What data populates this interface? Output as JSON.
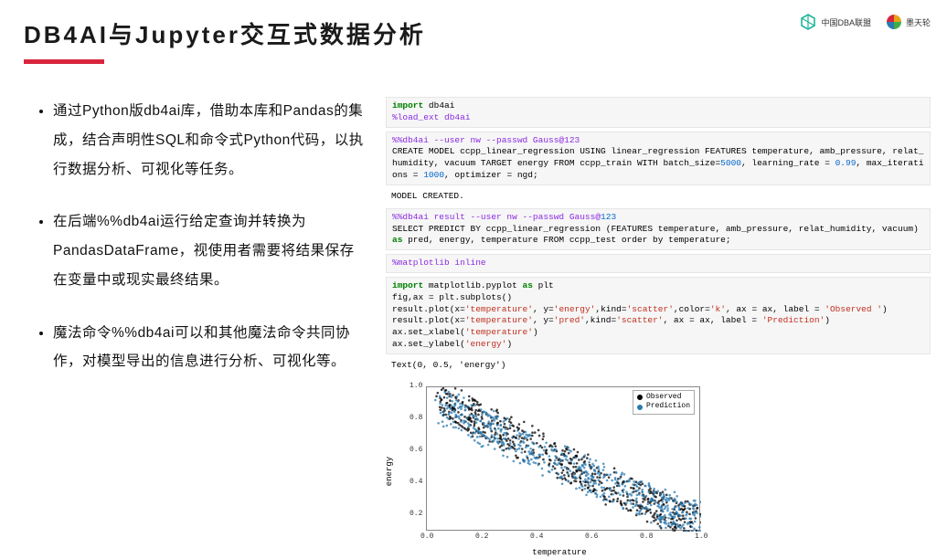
{
  "title": "DB4AI与Jupyter交互式数据分析",
  "logos": {
    "left_text": "中国DBA联盟",
    "right_text": "墨天轮"
  },
  "bullets": [
    "通过Python版db4ai库，借助本库和Pandas的集成，结合声明性SQL和命令式Python代码，以执行数据分析、可视化等任务。",
    "在后端%%db4ai运行给定查询并转换为PandasDataFrame，视使用者需要将结果保存在变量中或现实最终结果。",
    "魔法命令%%db4ai可以和其他魔法命令共同协作，对模型导出的信息进行分析、可视化等。"
  ],
  "code_cells": {
    "c1a": "import",
    "c1b": " db4ai\n",
    "c1c": "%load_ext db4ai",
    "c2a": "%%db4ai --user nw --passwd Gauss@123",
    "c2b": "\nCREATE MODEL ccpp_linear_regression USING linear_regression FEATURES temperature, amb_pressure, relat_humidity, vacuum TARGET energy FROM ccpp_train WITH batch_size=",
    "c2c": "5000",
    "c2d": ", learning_rate = ",
    "c2e": "0.99",
    "c2f": ", max_iterations = ",
    "c2g": "1000",
    "c2h": ", optimizer = ngd;",
    "out1": "MODEL CREATED.",
    "c3a": "%%db4ai result --user nw --passwd Gauss@",
    "c3b": "123",
    "c3c": "\nSELECT PREDICT BY ccpp_linear_regression (FEATURES temperature, amb_pressure, relat_humidity, vacuum) ",
    "c3d": "as",
    "c3e": " pred, energy, temperature FROM ccpp_test order by temperature;",
    "c4": "%matplotlib inline",
    "c5a": "import",
    "c5b": " matplotlib.pyplot ",
    "c5c": "as",
    "c5d": " plt\nfig,ax = plt.subplots()\nresult.plot(x=",
    "c5e": "'temperature'",
    "c5f": ", y=",
    "c5g": "'energy'",
    "c5h": ",kind=",
    "c5i": "'scatter'",
    "c5j": ",color=",
    "c5k": "'k'",
    "c5l": ", ax = ax, label = ",
    "c5m": "'Observed '",
    "c5n": ")\nresult.plot(x=",
    "c5o": "'temperature'",
    "c5p": ", y=",
    "c5q": "'pred'",
    "c5r": ",kind=",
    "c5s": "'scatter'",
    "c5t": ", ax = ax, label = ",
    "c5u": "'Prediction'",
    "c5v": ")\nax.set_xlabel(",
    "c5w": "'temperature'",
    "c5x": ")\nax.set_ylabel(",
    "c5y": "'energy'",
    "c5z": ")",
    "out2": "Text(0, 0.5, 'energy')"
  },
  "chart_data": {
    "type": "scatter",
    "title": "",
    "xlabel": "temperature",
    "ylabel": "energy",
    "xlim": [
      0.0,
      1.0
    ],
    "ylim": [
      0.1,
      1.0
    ],
    "xticks": [
      0.0,
      0.2,
      0.4,
      0.6,
      0.8,
      1.0
    ],
    "yticks": [
      0.2,
      0.4,
      0.6,
      0.8,
      1.0
    ],
    "legend": [
      "Observed",
      "Prediction"
    ],
    "legend_colors": [
      "#000000",
      "#2a7ab0"
    ],
    "series": [
      {
        "name": "Observed",
        "color": "#000000",
        "description": "Dense scatter cloud with strong negative correlation; values span roughly x=[0.03,0.98], y=[0.12,0.97], width of cloud about ±0.12 around a downward trend.",
        "approx_trend": [
          [
            0.05,
            0.92
          ],
          [
            0.25,
            0.75
          ],
          [
            0.45,
            0.58
          ],
          [
            0.65,
            0.4
          ],
          [
            0.85,
            0.25
          ],
          [
            0.98,
            0.15
          ]
        ]
      },
      {
        "name": "Prediction",
        "color": "#2a7ab0",
        "description": "Similar dense negative-trend band overlapping Observed, centered slightly tighter around regression line.",
        "approx_trend": [
          [
            0.05,
            0.88
          ],
          [
            0.25,
            0.72
          ],
          [
            0.45,
            0.55
          ],
          [
            0.65,
            0.4
          ],
          [
            0.85,
            0.26
          ],
          [
            0.98,
            0.17
          ]
        ]
      }
    ]
  }
}
